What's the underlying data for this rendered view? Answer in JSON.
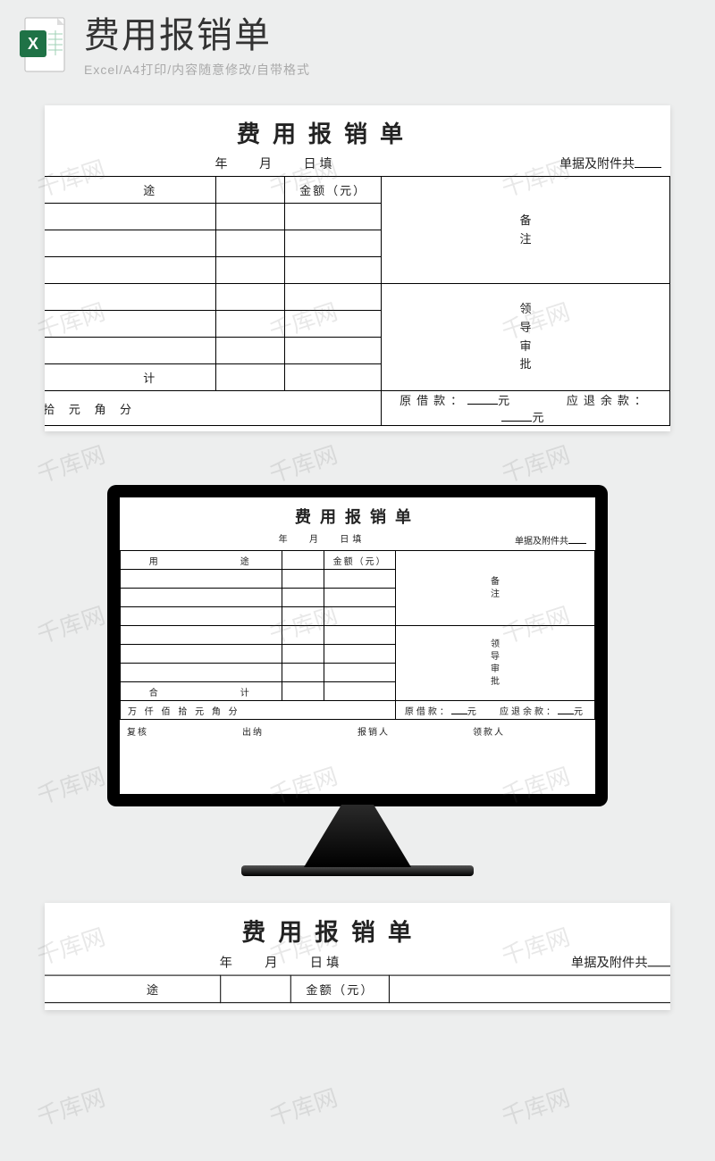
{
  "header": {
    "title": "费用报销单",
    "subtitle": "Excel/A4打印/内容随意修改/自带格式"
  },
  "form": {
    "title": "费用报销单",
    "date_year": "年",
    "date_month": "月",
    "date_day_fill": "日填",
    "attach_label": "单据及附件共",
    "col_purpose": "用　　途",
    "col_amount": "金额（元）",
    "side_remark": "备\n注",
    "side_approve": "领\n导\n审\n批",
    "total_label": "合　　计",
    "cn_units_full": "万 仟 佰 拾 元 角 分",
    "cn_units_crop": "仟 佰 拾 元 角 分",
    "loan_prev_label": "原借款：",
    "loan_refund_label": "应退余款：",
    "unit_yuan": "元",
    "sign_review": "复核",
    "sign_cashier": "出纳",
    "sign_reimburser": "报销人",
    "sign_payee": "领款人"
  },
  "watermark": "千库网"
}
